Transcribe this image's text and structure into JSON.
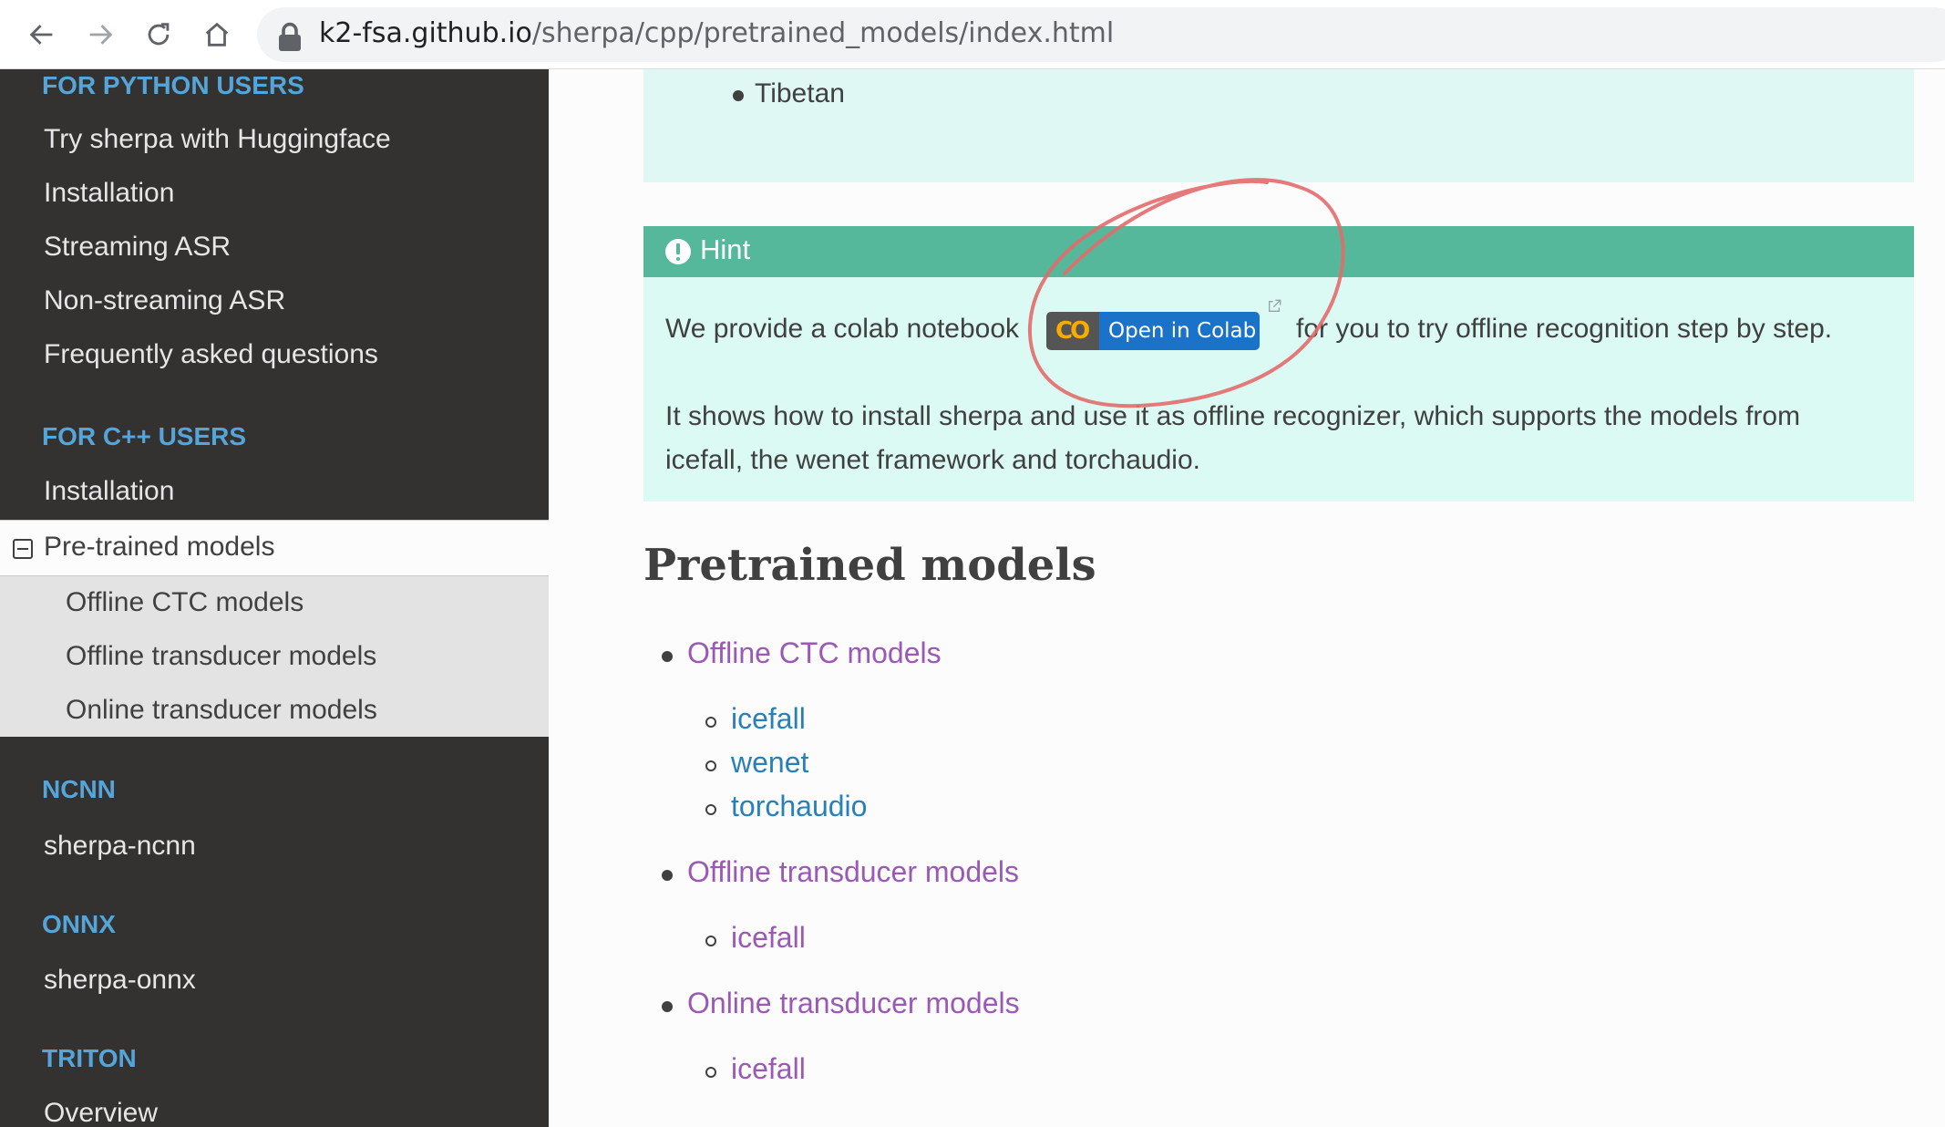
{
  "browser": {
    "url_host": "k2-fsa.github.io",
    "url_path": "/sherpa/cpp/pretrained_models/index.html",
    "icons": [
      "back-arrow-icon",
      "forward-arrow-icon",
      "reload-icon",
      "home-icon",
      "lock-icon"
    ]
  },
  "sidebar": {
    "python_caption": "FOR PYTHON USERS",
    "python_items": [
      "Try sherpa with Huggingface",
      "Installation",
      "Streaming ASR",
      "Non-streaming ASR",
      "Frequently asked questions"
    ],
    "cpp_caption": "FOR C++ USERS",
    "cpp_items": [
      "Installation"
    ],
    "current": "Pre-trained models",
    "current_children": [
      "Offline CTC models",
      "Offline transducer models",
      "Online transducer models"
    ],
    "ncnn_caption": "NCNN",
    "ncnn_items": [
      "sherpa-ncnn"
    ],
    "onnx_caption": "ONNX",
    "onnx_items": [
      "sherpa-onnx"
    ],
    "triton_caption": "TRITON",
    "triton_items": [
      "Overview"
    ]
  },
  "main": {
    "top_list_item": "Tibetan",
    "hint": {
      "title": "Hint",
      "before_badge": "We provide a colab notebook",
      "badge_label": "Open in Colab",
      "badge_logo": "CO",
      "after_badge": "for you to try offline recognition step by step.",
      "para2_line1": "It shows how to install sherpa and use it as offline recognizer, which supports the models from",
      "para2_line2": "icefall, the wenet framework and torchaudio."
    },
    "heading": "Pretrained models",
    "toc": [
      {
        "label": "Offline CTC models",
        "children": [
          "icefall",
          "wenet",
          "torchaudio"
        ]
      },
      {
        "label": "Offline transducer models",
        "children": [
          "icefall"
        ]
      },
      {
        "label": "Online transducer models",
        "children": [
          "icefall"
        ]
      }
    ]
  },
  "colors": {
    "sidebar_bg": "#343131",
    "caption": "#55a5d9",
    "hint_header": "#55b89b",
    "hint_bg": "#dbfaf4",
    "link_visited": "#9b59b6",
    "link": "#2980b9",
    "annotation": "#e06060"
  }
}
